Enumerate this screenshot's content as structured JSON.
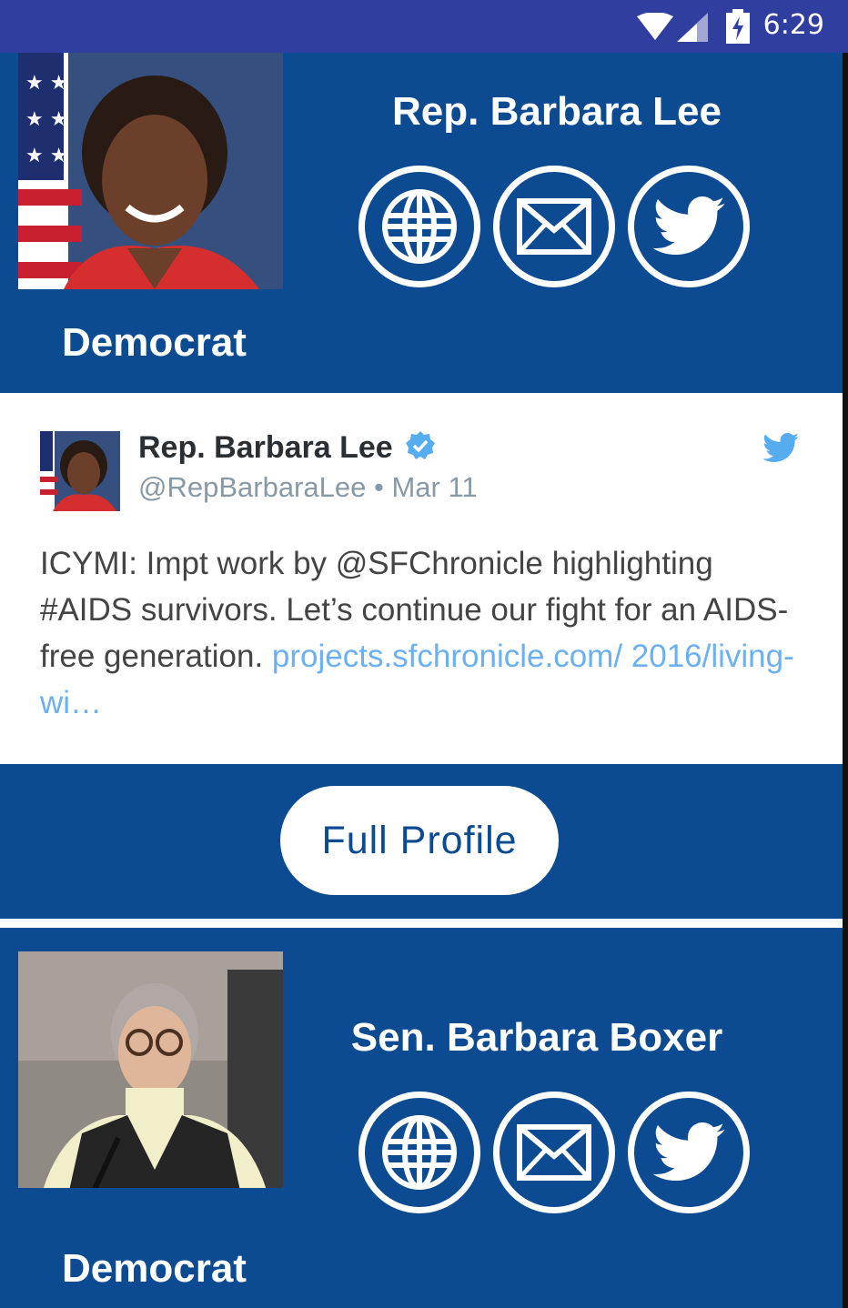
{
  "status_bar": {
    "time": "6:29",
    "icons": [
      "wifi-icon",
      "signal-icon",
      "battery-charging-icon"
    ]
  },
  "representatives": [
    {
      "name": "Rep. Barbara Lee",
      "party": "Democrat",
      "actions": [
        "globe-icon",
        "mail-icon",
        "twitter-icon"
      ]
    },
    {
      "name": "Sen. Barbara Boxer",
      "party": "Democrat",
      "actions": [
        "globe-icon",
        "mail-icon",
        "twitter-icon"
      ]
    }
  ],
  "tweet": {
    "author": "Rep. Barbara Lee",
    "handle": "@RepBarbaraLee",
    "separator": "•",
    "date": "Mar 11",
    "text": "ICYMI: Impt work by @SFChronicle highlighting #AIDS survivors. Let’s continue our fight for an AIDS-free generation. ",
    "link": "projects.sfchronicle.com/ 2016/living-wi…"
  },
  "full_profile_label": "Full Profile",
  "colors": {
    "background": "#0c4b91",
    "status_bar": "#303f9f",
    "tweet_link": "#6bb0f3",
    "verified": "#55acee"
  }
}
